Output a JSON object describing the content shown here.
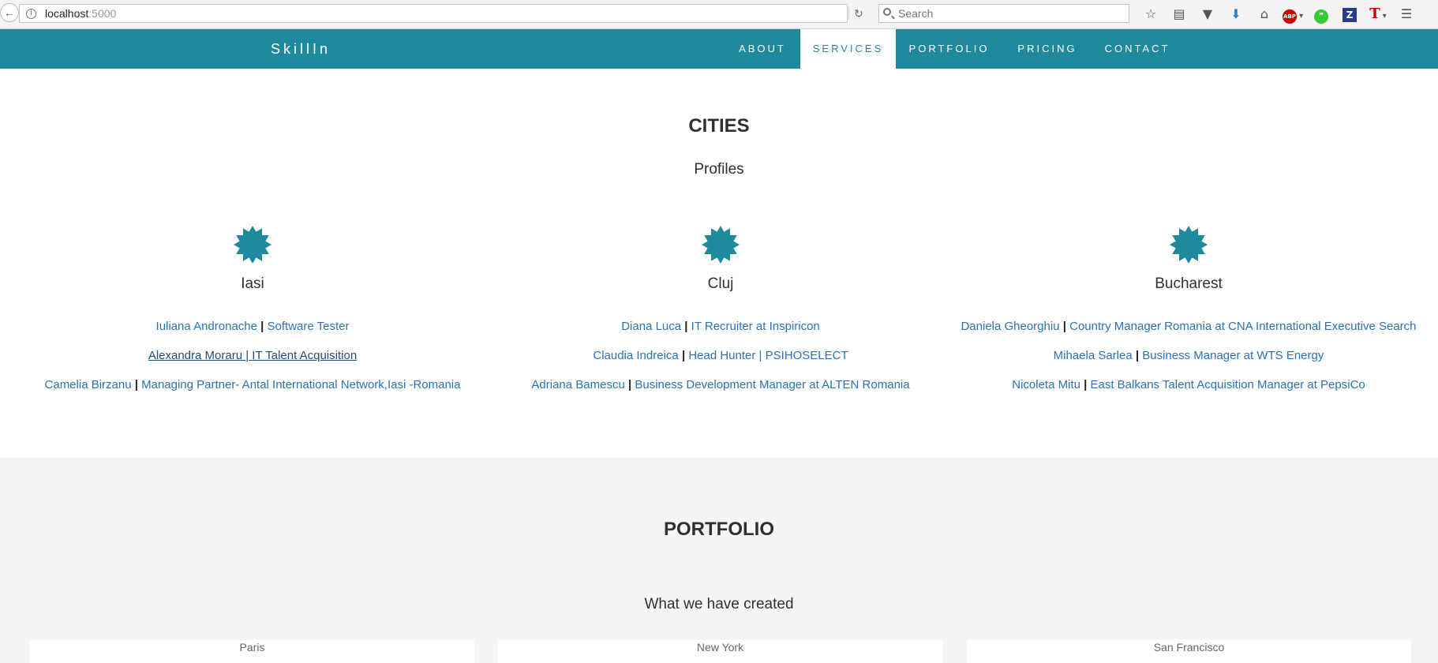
{
  "browser": {
    "url_host": "localhost",
    "url_port": ":5000",
    "search_placeholder": "Search"
  },
  "toolbar_icons": [
    "star-icon",
    "reader-icon",
    "pocket-icon",
    "download-icon",
    "home-icon",
    "adblock-icon",
    "quote-icon",
    "zotero-icon",
    "t-icon",
    "menu-icon"
  ],
  "navbar": {
    "brand": "SkillIn",
    "items": [
      {
        "label": "ABOUT",
        "active": false
      },
      {
        "label": "SERVICES",
        "active": true
      },
      {
        "label": "PORTFOLIO",
        "active": false
      },
      {
        "label": "PRICING",
        "active": false
      },
      {
        "label": "CONTACT",
        "active": false
      }
    ]
  },
  "cities": {
    "title": "CITIES",
    "subtitle": "Profiles",
    "accent_color": "#1f8a9e",
    "columns": [
      {
        "name": "Iasi",
        "profiles": [
          {
            "person": "Iuliana Andronache",
            "role": "Software Tester"
          },
          {
            "person": "Alexandra Moraru",
            "role": "IT Talent Acquisition"
          },
          {
            "person": "Camelia Birzanu",
            "role": "Managing Partner- Antal International Network,Iasi -Romania"
          }
        ]
      },
      {
        "name": "Cluj",
        "profiles": [
          {
            "person": "Diana Luca",
            "role": "IT Recruiter at Inspiricon"
          },
          {
            "person": "Claudia Indreica",
            "role": "Head Hunter | PSIHOSELECT"
          },
          {
            "person": "Adriana Bamescu",
            "role": "Business Development Manager at ALTEN Romania"
          }
        ]
      },
      {
        "name": "Bucharest",
        "profiles": [
          {
            "person": "Daniela Gheorghiu",
            "role": "Country Manager Romania at CNA International Executive Search"
          },
          {
            "person": "Mihaela Sarlea",
            "role": "Business Manager at WTS Energy"
          },
          {
            "person": "Nicoleta Mitu",
            "role": "East Balkans Talent Acquisition Manager at PepsiCo"
          }
        ]
      }
    ]
  },
  "portfolio": {
    "title": "PORTFOLIO",
    "subtitle": "What we have created",
    "cards": [
      "Paris",
      "New York",
      "San Francisco"
    ]
  },
  "separator": "|"
}
